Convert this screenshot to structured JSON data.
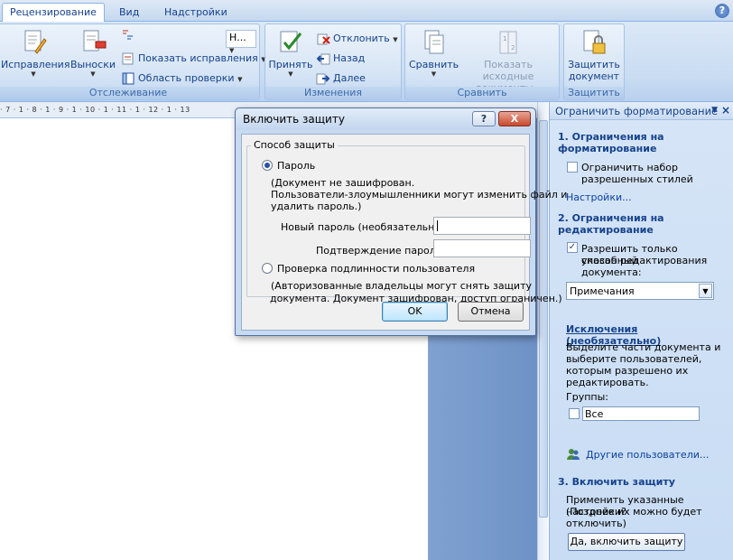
{
  "ribbon": {
    "tabs": [
      "Рецензирование",
      "Вид",
      "Надстройки"
    ],
    "help_icon": "?",
    "groups": {
      "tracking": {
        "label": "Отслеживание",
        "track_changes": "Исправления",
        "balloons": "Выноски",
        "display_combo": "Н...",
        "show_markup": "Показать исправления",
        "reviewing_pane": "Область проверки"
      },
      "changes": {
        "label": "Изменения",
        "accept": "Принять",
        "reject": "Отклонить",
        "previous": "Назад",
        "next": "Далее"
      },
      "compare": {
        "label": "Сравнить",
        "compare": "Сравнить",
        "show_source_line1": "Показать исходные",
        "show_source_line2": "документы"
      },
      "protect": {
        "label": "Защитить",
        "protect_line1": "Защитить",
        "protect_line2": "документ"
      }
    }
  },
  "ruler": {
    "marks": "· 7 · 1 · 8 · 1 · 9 · 1 · 10 · 1 · 11 · 1 · 12 · 1 · 13"
  },
  "pane": {
    "title": "Ограничить форматирование",
    "s1_title_line1": "1. Ограничения на",
    "s1_title_line2": "форматирование",
    "s1_check_line1": "Ограничить набор",
    "s1_check_line2": "разрешенных стилей",
    "s1_settings": "Настройки...",
    "s2_title_line1": "2. Ограничения на",
    "s2_title_line2": "редактирование",
    "s2_check_line1": "Разрешить только указанный",
    "s2_check_line2": "способ редактирования",
    "s2_check_line3": "документа:",
    "s2_select": "Примечания",
    "exceptions_title": "Исключения (необязательно)",
    "exceptions_line1": "Выделите части документа и",
    "exceptions_line2": "выберите пользователей,",
    "exceptions_line3": "которым разрешено их",
    "exceptions_line4": "редактировать.",
    "groups_label": "Группы:",
    "group_all": "Все",
    "other_users": "Другие пользователи...",
    "s3_title": "3. Включить защиту",
    "s3_line1": "Применить указанные настройки?",
    "s3_line2": "(Позднее их можно будет",
    "s3_line3": "отключить)",
    "s3_button": "Да, включить защиту"
  },
  "dialog": {
    "title": "Включить защиту",
    "help": "?",
    "close": "X",
    "legend": "Способ защиты",
    "password_radio": "Пароль",
    "password_desc_line1": "(Документ не зашифрован.",
    "password_desc_line2": "Пользователи-злоумышленники могут изменить файл и",
    "password_desc_line3": "удалить пароль.)",
    "new_password_label": "Новый пароль (необязательно):",
    "confirm_password_label": "Подтверждение пароля:",
    "auth_radio": "Проверка подлинности пользователя",
    "auth_desc_line1": "(Авторизованные владельцы могут снять защиту",
    "auth_desc_line2": "документа. Документ зашифрован, доступ ограничен.)",
    "ok": "OK",
    "cancel": "Отмена"
  },
  "colors": {
    "ribbon_text": "#15428b",
    "pane_bg": "#d6e5f7",
    "accent_link": "#0b40a0"
  }
}
